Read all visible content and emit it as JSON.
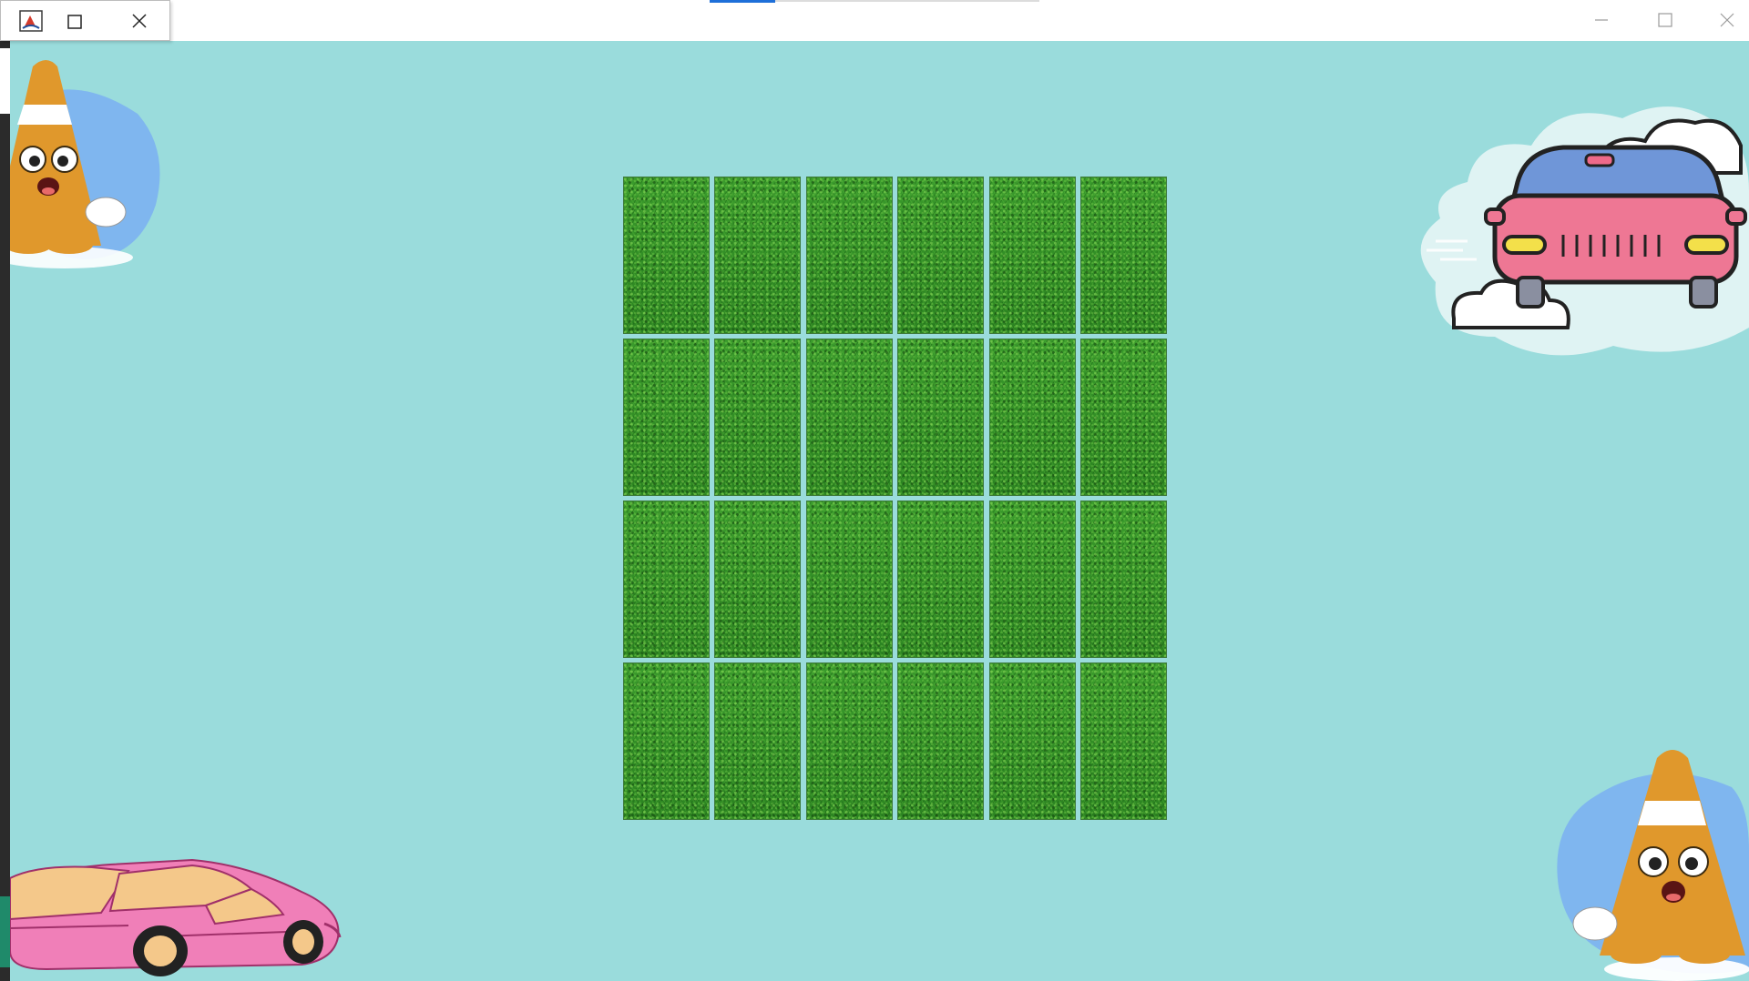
{
  "window": {
    "title": "",
    "accent_color": "#1e6fd9",
    "controls": [
      "minimize-icon",
      "maximize-icon",
      "close-icon"
    ]
  },
  "game": {
    "background_color": "#9adcdc",
    "board": {
      "rows": 4,
      "columns": 6,
      "tile_state": "face-down",
      "tile_back": "grass",
      "tile_color": "#2f8f25"
    },
    "decorations": [
      "traffic-cone-character",
      "pink-car-front-in-cloud",
      "pink-sports-car",
      "traffic-cone-character"
    ]
  }
}
